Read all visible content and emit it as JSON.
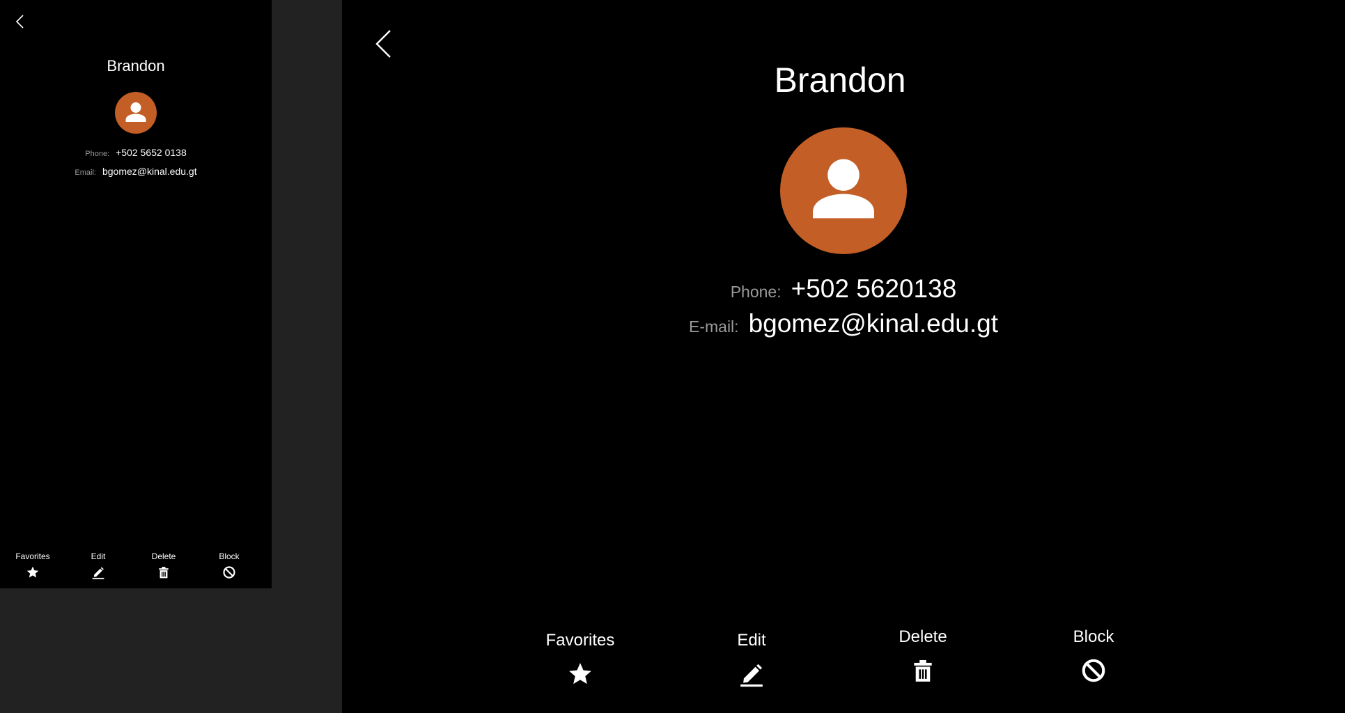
{
  "contact": {
    "name": "Brandon",
    "avatar_color": "#C25E26",
    "avatar_icon": "person-icon"
  },
  "small_view": {
    "phone_label": "Phone:",
    "phone_value": "+502 5652 0138",
    "email_label": "Email:",
    "email_value": "bgomez@kinal.edu.gt"
  },
  "large_view": {
    "phone_label": "Phone:",
    "phone_value": "+502 5620138",
    "email_label": "E-mail:",
    "email_value": "bgomez@kinal.edu.gt"
  },
  "actions": [
    {
      "label": "Favorites",
      "icon": "star-icon"
    },
    {
      "label": "Edit",
      "icon": "pencil-icon"
    },
    {
      "label": "Delete",
      "icon": "trash-icon"
    },
    {
      "label": "Block",
      "icon": "block-icon"
    }
  ],
  "colors": {
    "background": "#000000",
    "canvas": "#222222",
    "label_gray": "#9A9A9A",
    "accent": "#C25E26"
  }
}
